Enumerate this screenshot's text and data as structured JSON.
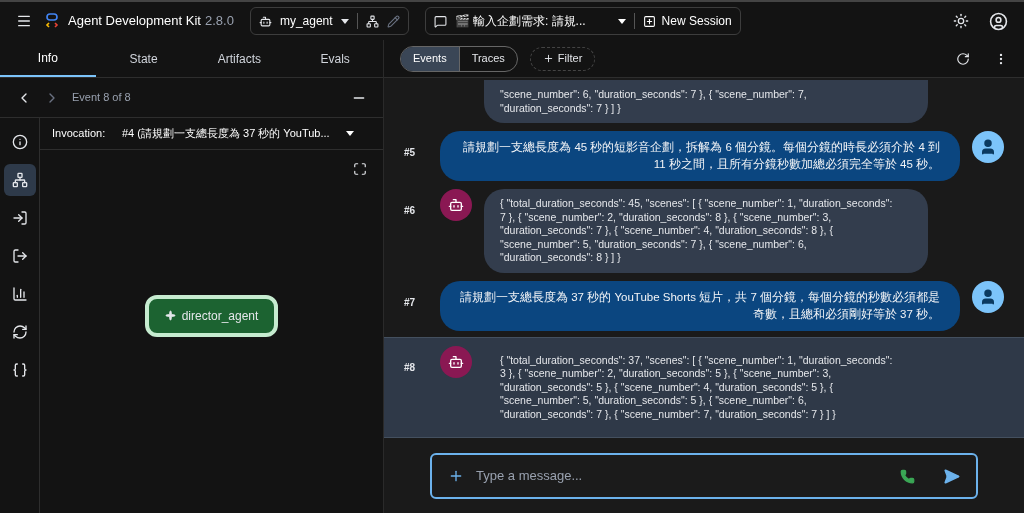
{
  "header": {
    "app_name": "Agent Development Kit",
    "version": "2.8.0",
    "agent": "my_agent",
    "session": "🎬 輸入企劃需求: 請規...",
    "new_session": "New Session"
  },
  "left_tabs": [
    {
      "label": "Info",
      "selected": true
    },
    {
      "label": "State",
      "selected": false
    },
    {
      "label": "Artifacts",
      "selected": false
    },
    {
      "label": "Evals",
      "selected": false
    }
  ],
  "event_nav": {
    "label": "Event 8 of 8"
  },
  "side_icons": [
    {
      "kind": "info",
      "selected": false
    },
    {
      "kind": "graph",
      "selected": true
    },
    {
      "kind": "input",
      "selected": false
    },
    {
      "kind": "output",
      "selected": false
    },
    {
      "kind": "chart",
      "selected": false
    },
    {
      "kind": "sync",
      "selected": false
    },
    {
      "kind": "braces",
      "selected": false
    }
  ],
  "invocation": {
    "label": "Invocation:",
    "value": "#4 (請規劃一支總長度為 37 秒的 YouTub..."
  },
  "graph": {
    "node": "director_agent"
  },
  "right_tabs": [
    {
      "label": "Events",
      "selected": true
    },
    {
      "label": "Traces",
      "selected": false
    }
  ],
  "filter": "Filter",
  "messages": [
    {
      "kind": "continuation",
      "selected": false,
      "text": "\"scene_number\": 6, \"duration_seconds\": 7 }, { \"scene_number\": 7, \"duration_seconds\": 7 } ] }"
    },
    {
      "kind": "user",
      "number": "#5",
      "selected": false,
      "text": "請規劃一支總長度為 45 秒的短影音企劃，拆解為 6 個分鏡。每個分鏡的時長必須介於 4 到 11 秒之間，且所有分鏡秒數加總必須完全等於 45 秒。"
    },
    {
      "kind": "agent",
      "number": "#6",
      "selected": false,
      "text": "{ \"total_duration_seconds\": 45, \"scenes\": [ { \"scene_number\": 1, \"duration_seconds\": 7 }, { \"scene_number\": 2, \"duration_seconds\": 8 }, { \"scene_number\": 3, \"duration_seconds\": 7 }, { \"scene_number\": 4, \"duration_seconds\": 8 }, { \"scene_number\": 5, \"duration_seconds\": 7 }, { \"scene_number\": 6, \"duration_seconds\": 8 } ] }"
    },
    {
      "kind": "user",
      "number": "#7",
      "selected": false,
      "text": "請規劃一支總長度為 37 秒的 YouTube Shorts 短片，共 7 個分鏡，每個分鏡的秒數必須都是奇數，且總和必須剛好等於 37 秒。"
    },
    {
      "kind": "agent",
      "number": "#8",
      "selected": true,
      "text": "{ \"total_duration_seconds\": 37, \"scenes\": [ { \"scene_number\": 1, \"duration_seconds\": 3 }, { \"scene_number\": 2, \"duration_seconds\": 5 }, { \"scene_number\": 3, \"duration_seconds\": 5 }, { \"scene_number\": 4, \"duration_seconds\": 5 }, { \"scene_number\": 5, \"duration_seconds\": 5 }, { \"scene_number\": 6, \"duration_seconds\": 7 }, { \"scene_number\": 7, \"duration_seconds\": 7 } ] }"
    }
  ],
  "composer": {
    "placeholder": "Type a message..."
  }
}
